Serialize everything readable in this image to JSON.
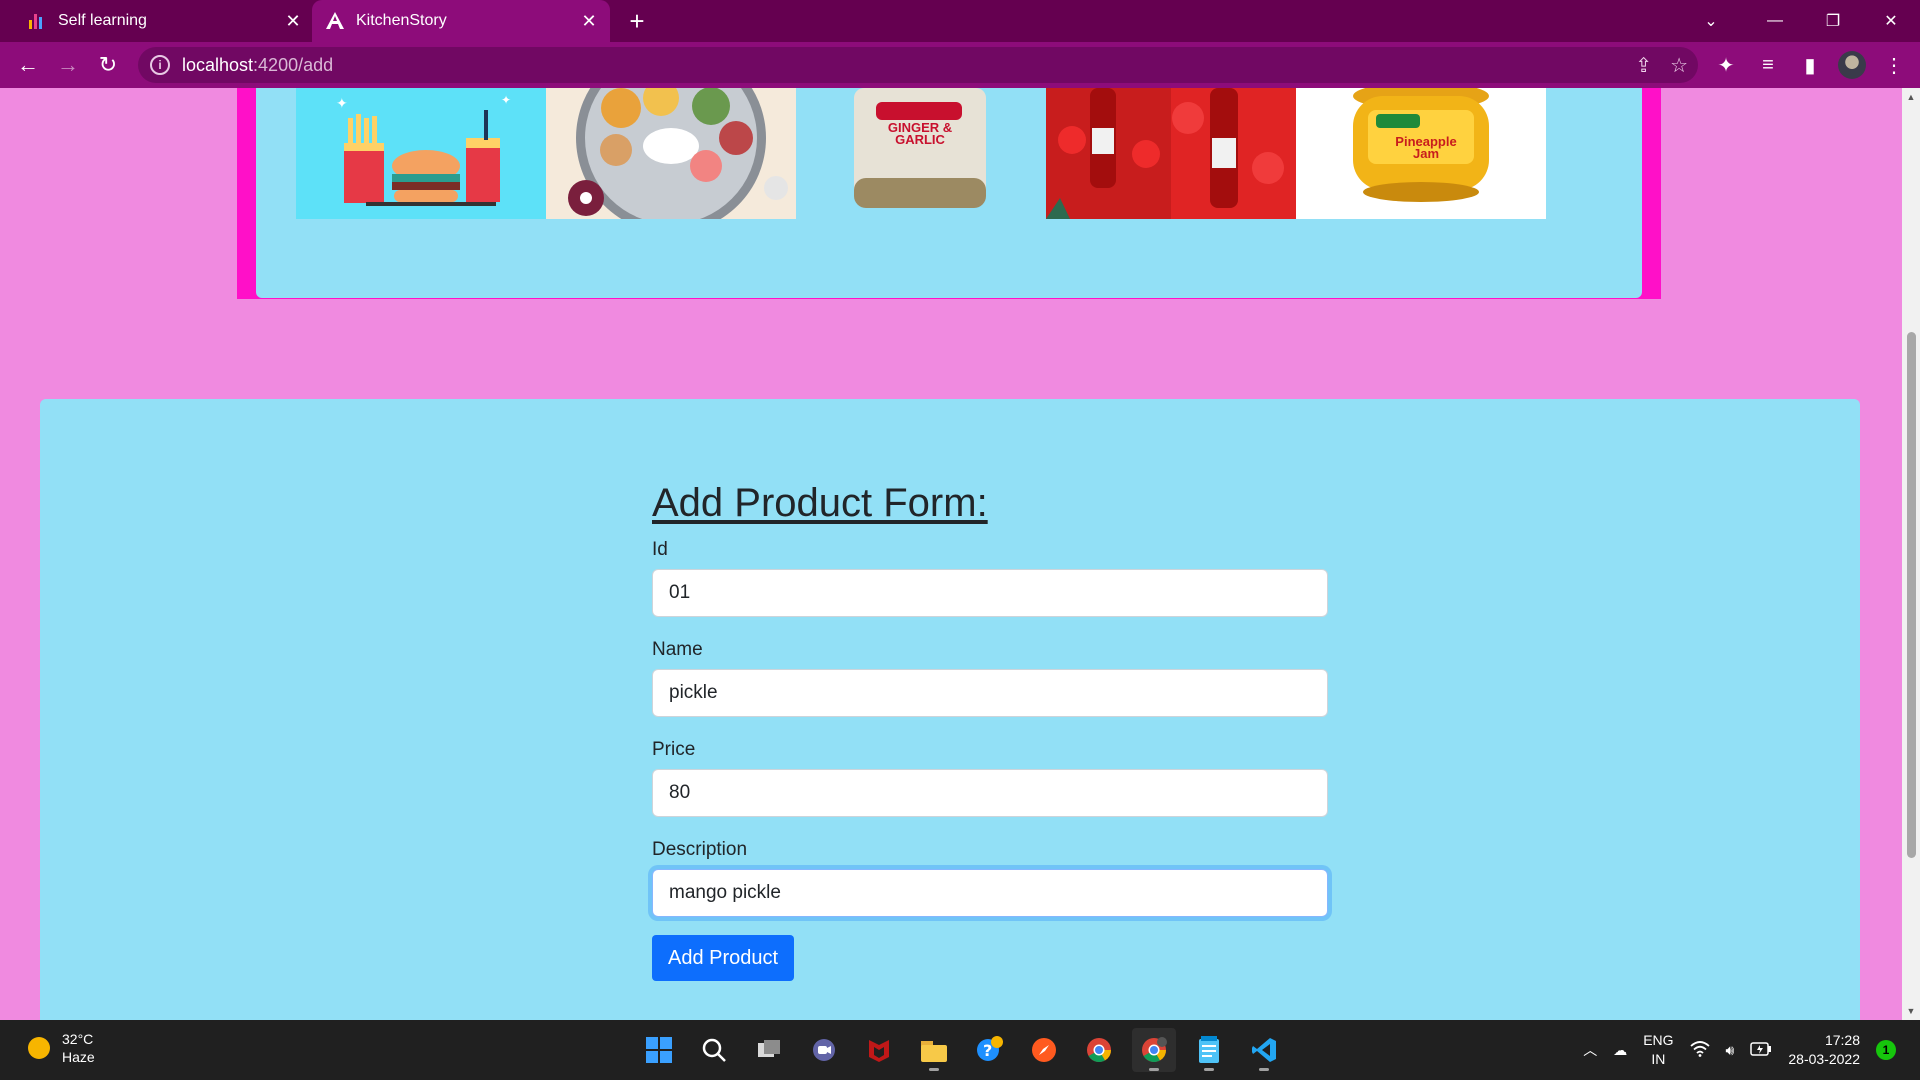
{
  "browser": {
    "tabs": [
      {
        "title": "Self learning",
        "icon": "bar-chart-icon"
      },
      {
        "title": "KitchenStory",
        "icon": "angular-icon",
        "active": true
      }
    ],
    "url_host": "localhost",
    "url_path": ":4200/add",
    "close_glyph": "✕",
    "new_tab_glyph": "+"
  },
  "gallery": {
    "images": [
      {
        "name": "fast-food-image",
        "label": ""
      },
      {
        "name": "thali-image",
        "label": ""
      },
      {
        "name": "ginger-garlic-jar-image",
        "label": "GINGER & GARLIC"
      },
      {
        "name": "ketchup-image",
        "label": ""
      },
      {
        "name": "pineapple-jam-image",
        "label": "Pineapple Jam"
      }
    ]
  },
  "form": {
    "title": "Add Product Form:",
    "fields": [
      {
        "label": "Id",
        "value": "01"
      },
      {
        "label": "Name",
        "value": "pickle"
      },
      {
        "label": "Price",
        "value": "80"
      },
      {
        "label": "Description",
        "value": "mango pickle"
      }
    ],
    "submit_label": "Add Product"
  },
  "taskbar": {
    "weather_temp": "32°C",
    "weather_desc": "Haze",
    "lang_top": "ENG",
    "lang_bottom": "IN",
    "time": "17:28",
    "date": "28-03-2022",
    "notification_count": "1"
  },
  "colors": {
    "page_bg": "#f08ae0",
    "card_bg": "#92e0f6",
    "accent": "#0d6efd",
    "browser_frame": "#650050"
  }
}
